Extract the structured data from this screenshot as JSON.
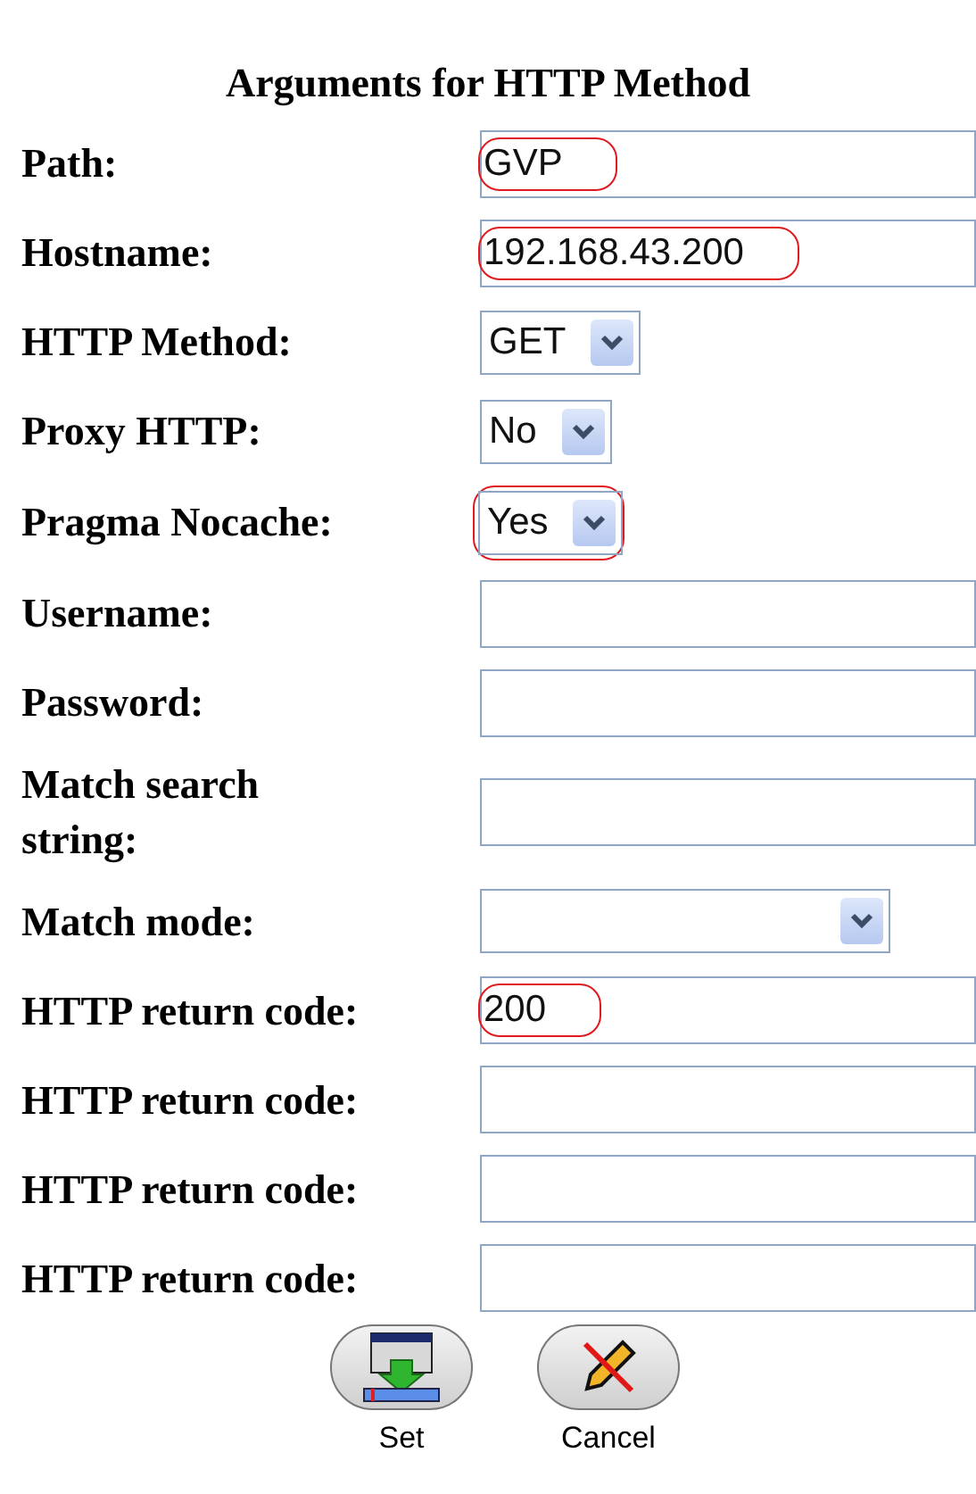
{
  "title": "Arguments for HTTP Method",
  "fields": [
    {
      "label": "Path:",
      "kind": "text",
      "value": "GVP",
      "highlighted": true
    },
    {
      "label": "Hostname:",
      "kind": "text",
      "value": "192.168.43.200",
      "highlighted": true
    },
    {
      "label": "HTTP Method:",
      "kind": "select",
      "value": "GET"
    },
    {
      "label": "Proxy HTTP:",
      "kind": "select",
      "value": "No"
    },
    {
      "label": "Pragma Nocache:",
      "kind": "select",
      "value": "Yes",
      "highlighted": true
    },
    {
      "label": "Username:",
      "kind": "text"
    },
    {
      "label": "Password:",
      "kind": "text"
    },
    {
      "label": "Match search string:",
      "kind": "text"
    },
    {
      "label": "Match mode:",
      "kind": "select"
    },
    {
      "label": "HTTP return code:",
      "kind": "text",
      "value": "200",
      "highlighted": true
    },
    {
      "label": "HTTP return code:",
      "kind": "text"
    },
    {
      "label": "HTTP return code:",
      "kind": "text"
    },
    {
      "label": "HTTP return code:",
      "kind": "text"
    }
  ],
  "buttons": [
    {
      "label": "Set",
      "kind": "set"
    },
    {
      "label": "Cancel",
      "kind": "cancel"
    }
  ]
}
